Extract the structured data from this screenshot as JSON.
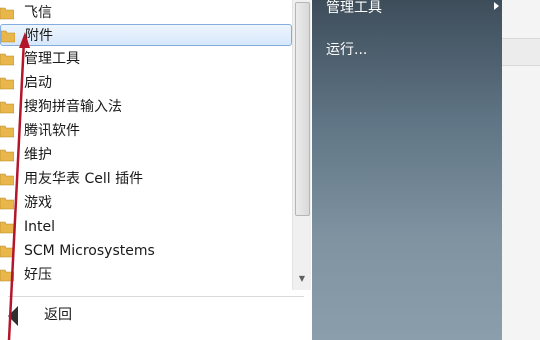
{
  "programs_list": {
    "items": [
      {
        "label": "飞信",
        "selected": false
      },
      {
        "label": "附件",
        "selected": true
      },
      {
        "label": "管理工具",
        "selected": false
      },
      {
        "label": "启动",
        "selected": false
      },
      {
        "label": "搜狗拼音输入法",
        "selected": false
      },
      {
        "label": "腾讯软件",
        "selected": false
      },
      {
        "label": "维护",
        "selected": false
      },
      {
        "label": "用友华表 Cell 插件",
        "selected": false
      },
      {
        "label": "游戏",
        "selected": false
      },
      {
        "label": "Intel",
        "selected": false
      },
      {
        "label": "SCM Microsystems",
        "selected": false
      },
      {
        "label": "好压",
        "selected": false
      }
    ],
    "back_label": "返回"
  },
  "right_menu": {
    "items": [
      {
        "label": "管理工具",
        "has_submenu": true
      },
      {
        "label": "运行...",
        "has_submenu": false
      }
    ]
  },
  "colors": {
    "selection_border": "#84acdd",
    "annotation_arrow": "#b3162a",
    "folder": "#e8b64a"
  }
}
